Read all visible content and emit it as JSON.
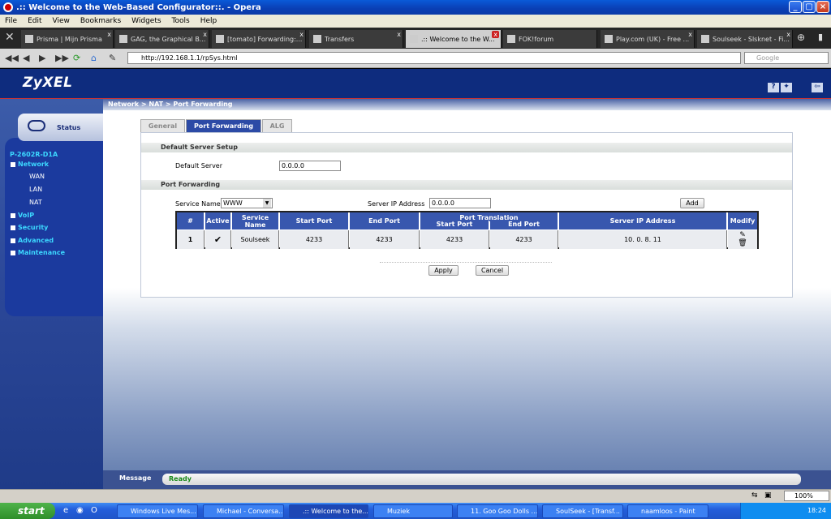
{
  "window": {
    "title": ".:: Welcome to the Web-Based Configurator::. - Opera"
  },
  "menu": [
    "File",
    "Edit",
    "View",
    "Bookmarks",
    "Widgets",
    "Tools",
    "Help"
  ],
  "tabs": [
    "Prisma | Mijn Prisma",
    "GAG, the Graphical B...",
    "[tomato] Forwarding:...",
    "Transfers",
    ".:: Welcome to the W...",
    "FOK!forum",
    "Play.com (UK) - Free ...",
    "Soulseek - Slsknet - Fi..."
  ],
  "address": {
    "url": "http://192.168.1.1/rpSys.html",
    "search_placeholder": "Google"
  },
  "banner": {
    "logo": "ZyXEL"
  },
  "breadcrumb": "Network > NAT > Port Forwarding",
  "sidebar": {
    "status_label": "Status",
    "device": "P-2602R-D1A",
    "network": "Network",
    "sub": [
      "WAN",
      "LAN",
      "NAT"
    ],
    "items": [
      "VoIP",
      "Security",
      "Advanced",
      "Maintenance"
    ]
  },
  "page_tabs": [
    "General",
    "Port Forwarding",
    "ALG"
  ],
  "default_server": {
    "section": "Default Server Setup",
    "label": "Default Server",
    "value": "0.0.0.0"
  },
  "port_forwarding": {
    "section": "Port Forwarding",
    "service_name_label": "Service Name",
    "service_name_value": "WWW",
    "server_ip_label": "Server IP Address",
    "server_ip_value": "0.0.0.0",
    "add_label": "Add",
    "headers": {
      "num": "#",
      "active": "Active",
      "service": "Service Name",
      "start": "Start Port",
      "end": "End Port",
      "translation": "Port Translation",
      "t_start": "Start Port",
      "t_end": "End Port",
      "ip": "Server IP Address",
      "modify": "Modify"
    },
    "rows": [
      {
        "num": "1",
        "service": "Soulseek",
        "start": "4233",
        "end": "4233",
        "t_start": "4233",
        "t_end": "4233",
        "ip": "10. 0. 8. 11"
      }
    ]
  },
  "buttons": {
    "apply": "Apply",
    "cancel": "Cancel"
  },
  "message": {
    "label": "Message",
    "text": "Ready"
  },
  "statusbar": {
    "zoom": "100%"
  },
  "taskbar": {
    "start": "start",
    "items": [
      "Windows Live Mes...",
      "Michael - Conversa...",
      ".:: Welcome to the...",
      "Muziek",
      "11. Goo Goo Dolls ...",
      "SoulSeek - [Transf...",
      "naamloos - Paint"
    ],
    "clock": "18:24"
  }
}
